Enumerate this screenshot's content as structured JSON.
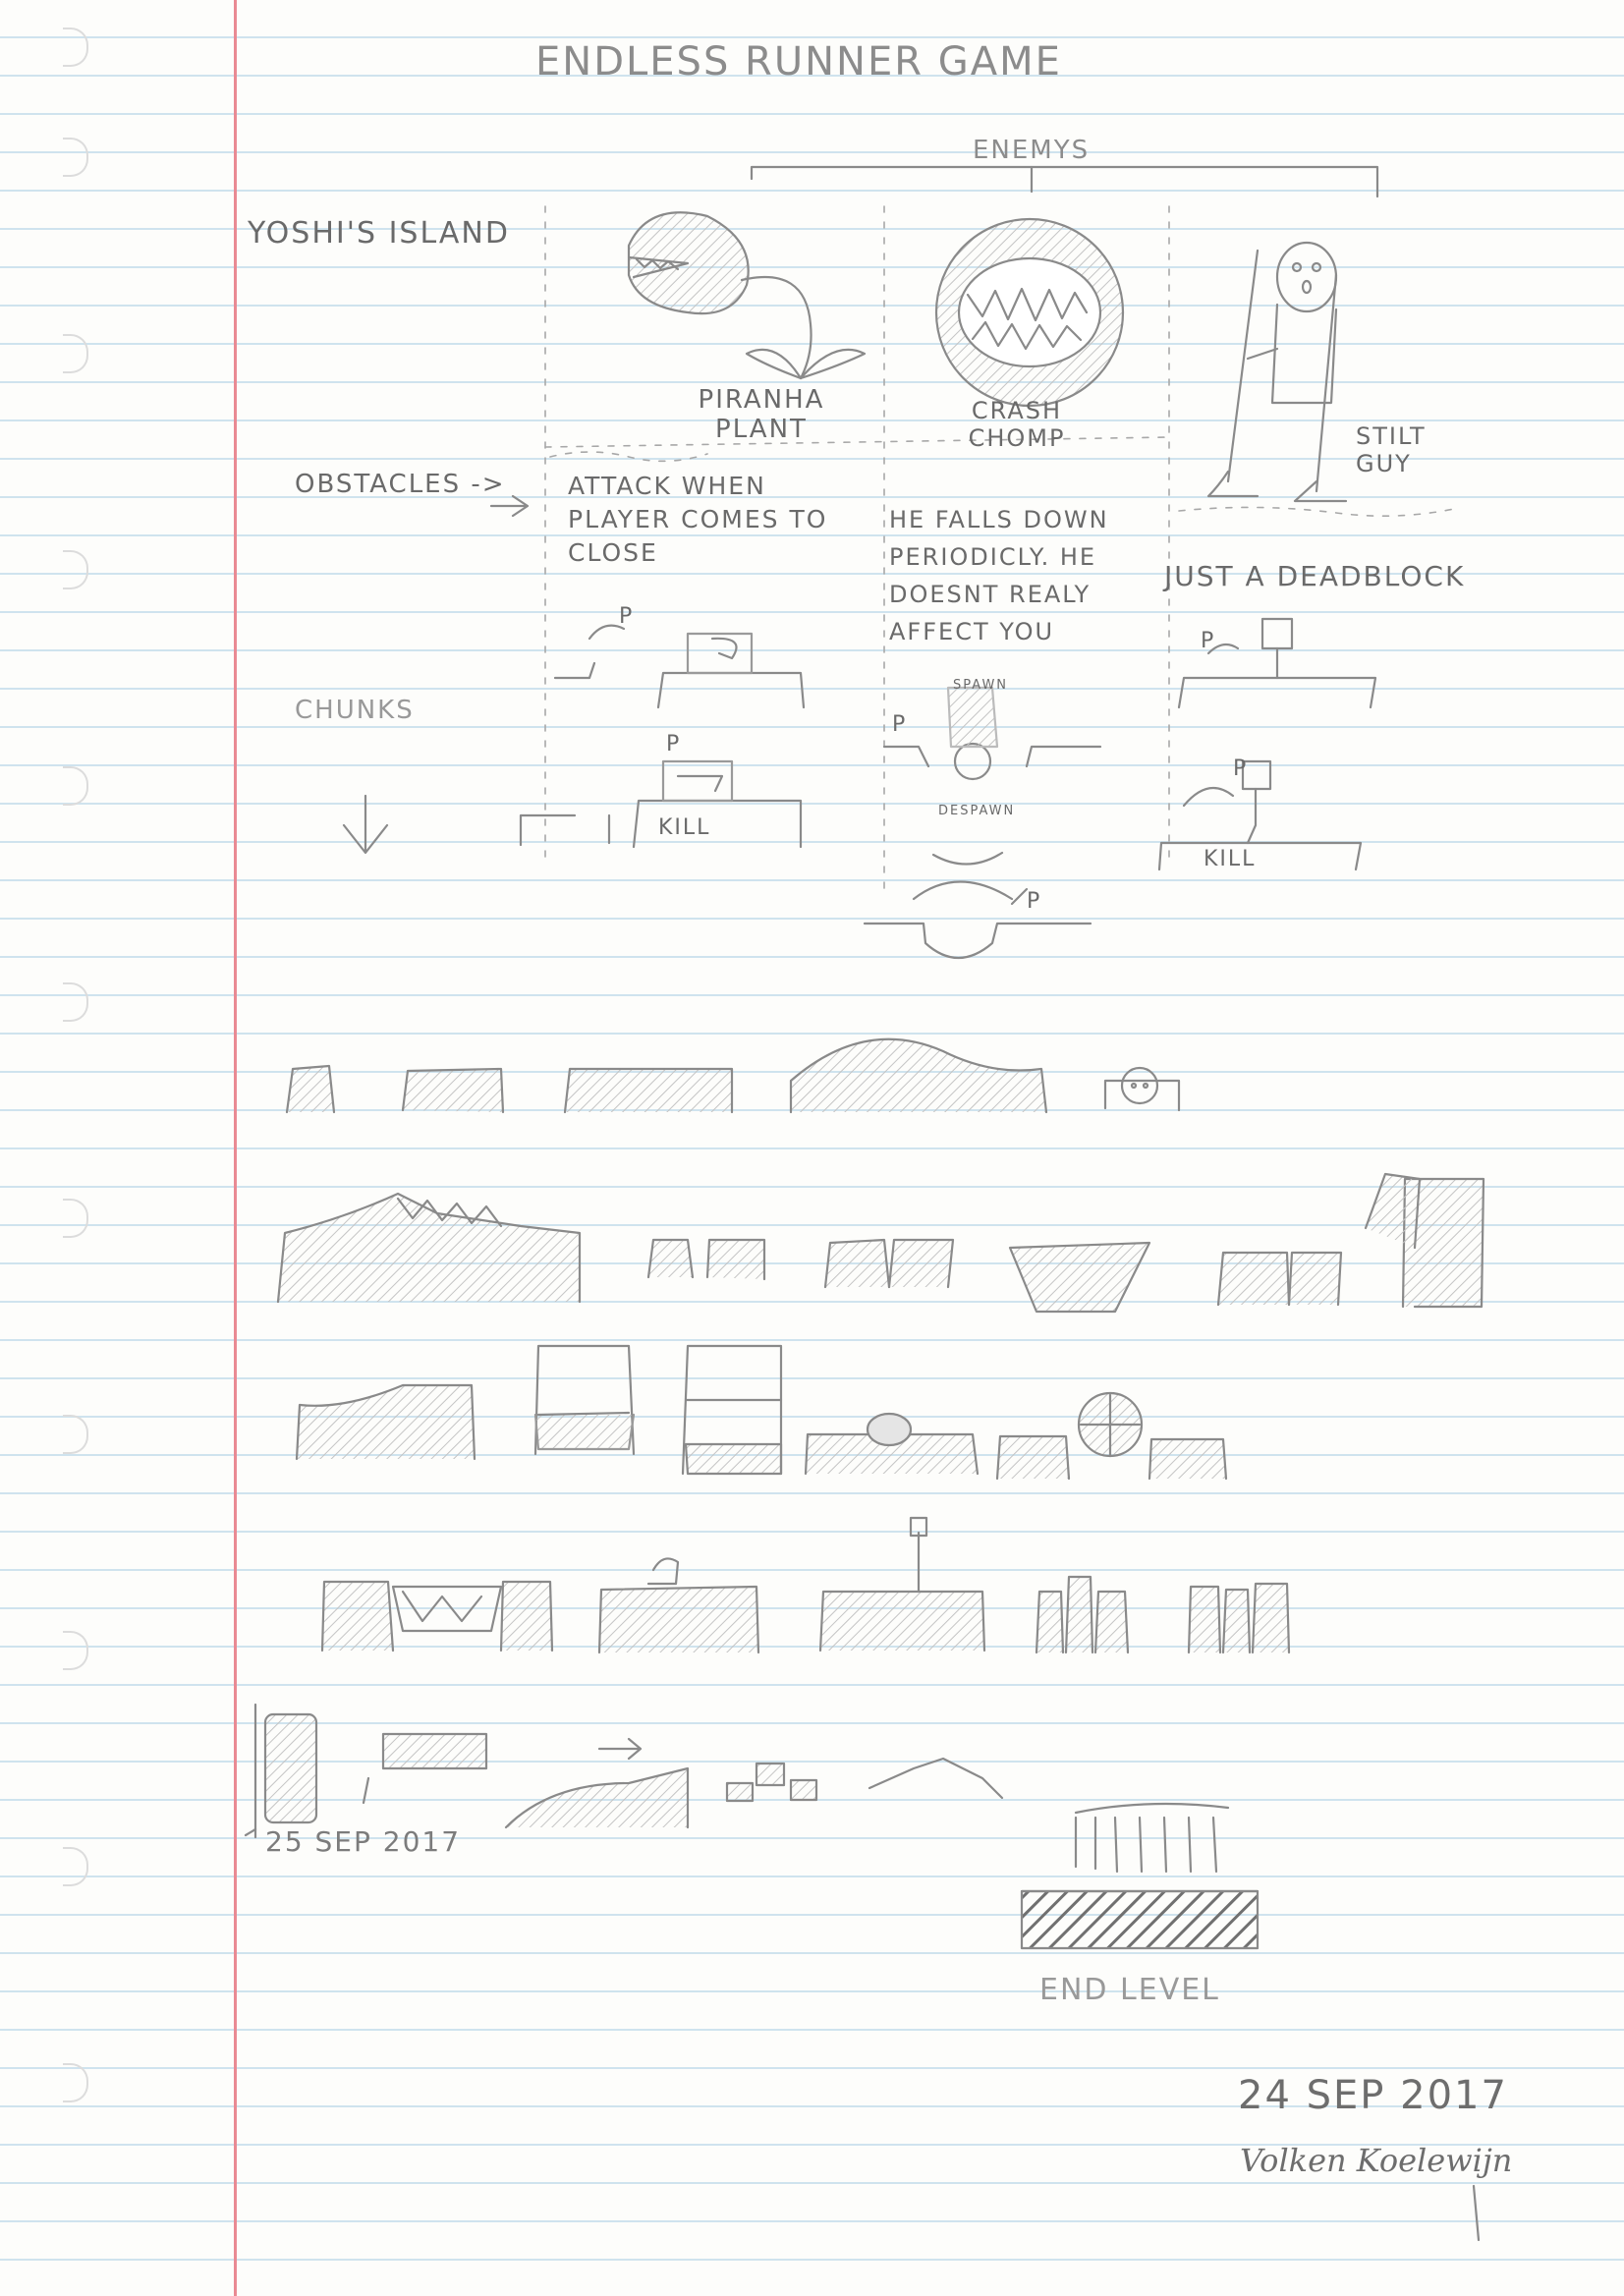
{
  "title": "ENDLESS RUNNER GAME",
  "enemies_header": "ENEMYS",
  "world_label": "YOSHI'S ISLAND",
  "enemies": [
    {
      "name": "PIRANHA PLANT",
      "behavior": "ATTACK WHEN PLAYER COMES TO CLOSE"
    },
    {
      "name": "CRASH CHOMP",
      "behavior": "HE FALLS DOWN PERIODICLY. HE DOESNT REALY AFFECT YOU"
    },
    {
      "name": "STILT GUY",
      "behavior": "JUST A DEADBLOCK"
    }
  ],
  "obstacles_label": "OBSTACLES ->",
  "chunks_label": "CHUNKS",
  "annotations": {
    "player_marker": "P",
    "kill_label": "KILL",
    "spawn_label": "SPAWN",
    "despawn_label": "DESPAWN"
  },
  "second_date": "25 SEP 2017",
  "end_level_label": "END LEVEL",
  "date": "24 SEP 2017",
  "author": "Volken Koelewijn"
}
